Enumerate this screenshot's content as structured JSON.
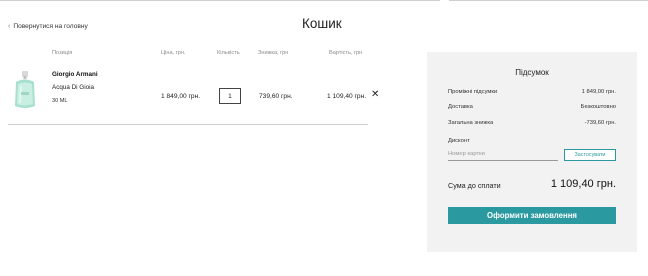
{
  "nav": {
    "back_label": "Повернутися на головну"
  },
  "page": {
    "title": "Кошик"
  },
  "table": {
    "headers": {
      "item": "Позиція",
      "price": "Ціна, грн.",
      "quantity": "Кількість",
      "discount": "Знижка, грн",
      "cost": "Вартість, грн"
    }
  },
  "cart": {
    "items": [
      {
        "brand": "Giorgio Armani",
        "model": "Acqua Di Gioia",
        "volume": "30 ML",
        "price": "1 849,00 грн.",
        "quantity": "1",
        "discount": "739,60 грн.",
        "cost": "1 109,40 грн.",
        "remove_icon": "close-icon"
      }
    ]
  },
  "summary": {
    "title": "Підсумок",
    "rows": [
      {
        "label": "Проміжні підсумки",
        "value": "1 849,00 грн."
      },
      {
        "label": "Доставка",
        "value": "Безкоштовно"
      },
      {
        "label": "Загальна знижка",
        "value": "-739,60 грн."
      }
    ],
    "discount_label": "Дисконт",
    "discount_placeholder": "Номер картки",
    "apply_label": "Застосувати",
    "total_label": "Сума до сплати",
    "total_value": "1 109,40 грн.",
    "checkout_label": "Оформити замовлення"
  },
  "colors": {
    "accent": "#2a9aa0",
    "panel_bg": "#f2f2f2",
    "divider": "#cfcfcf"
  }
}
